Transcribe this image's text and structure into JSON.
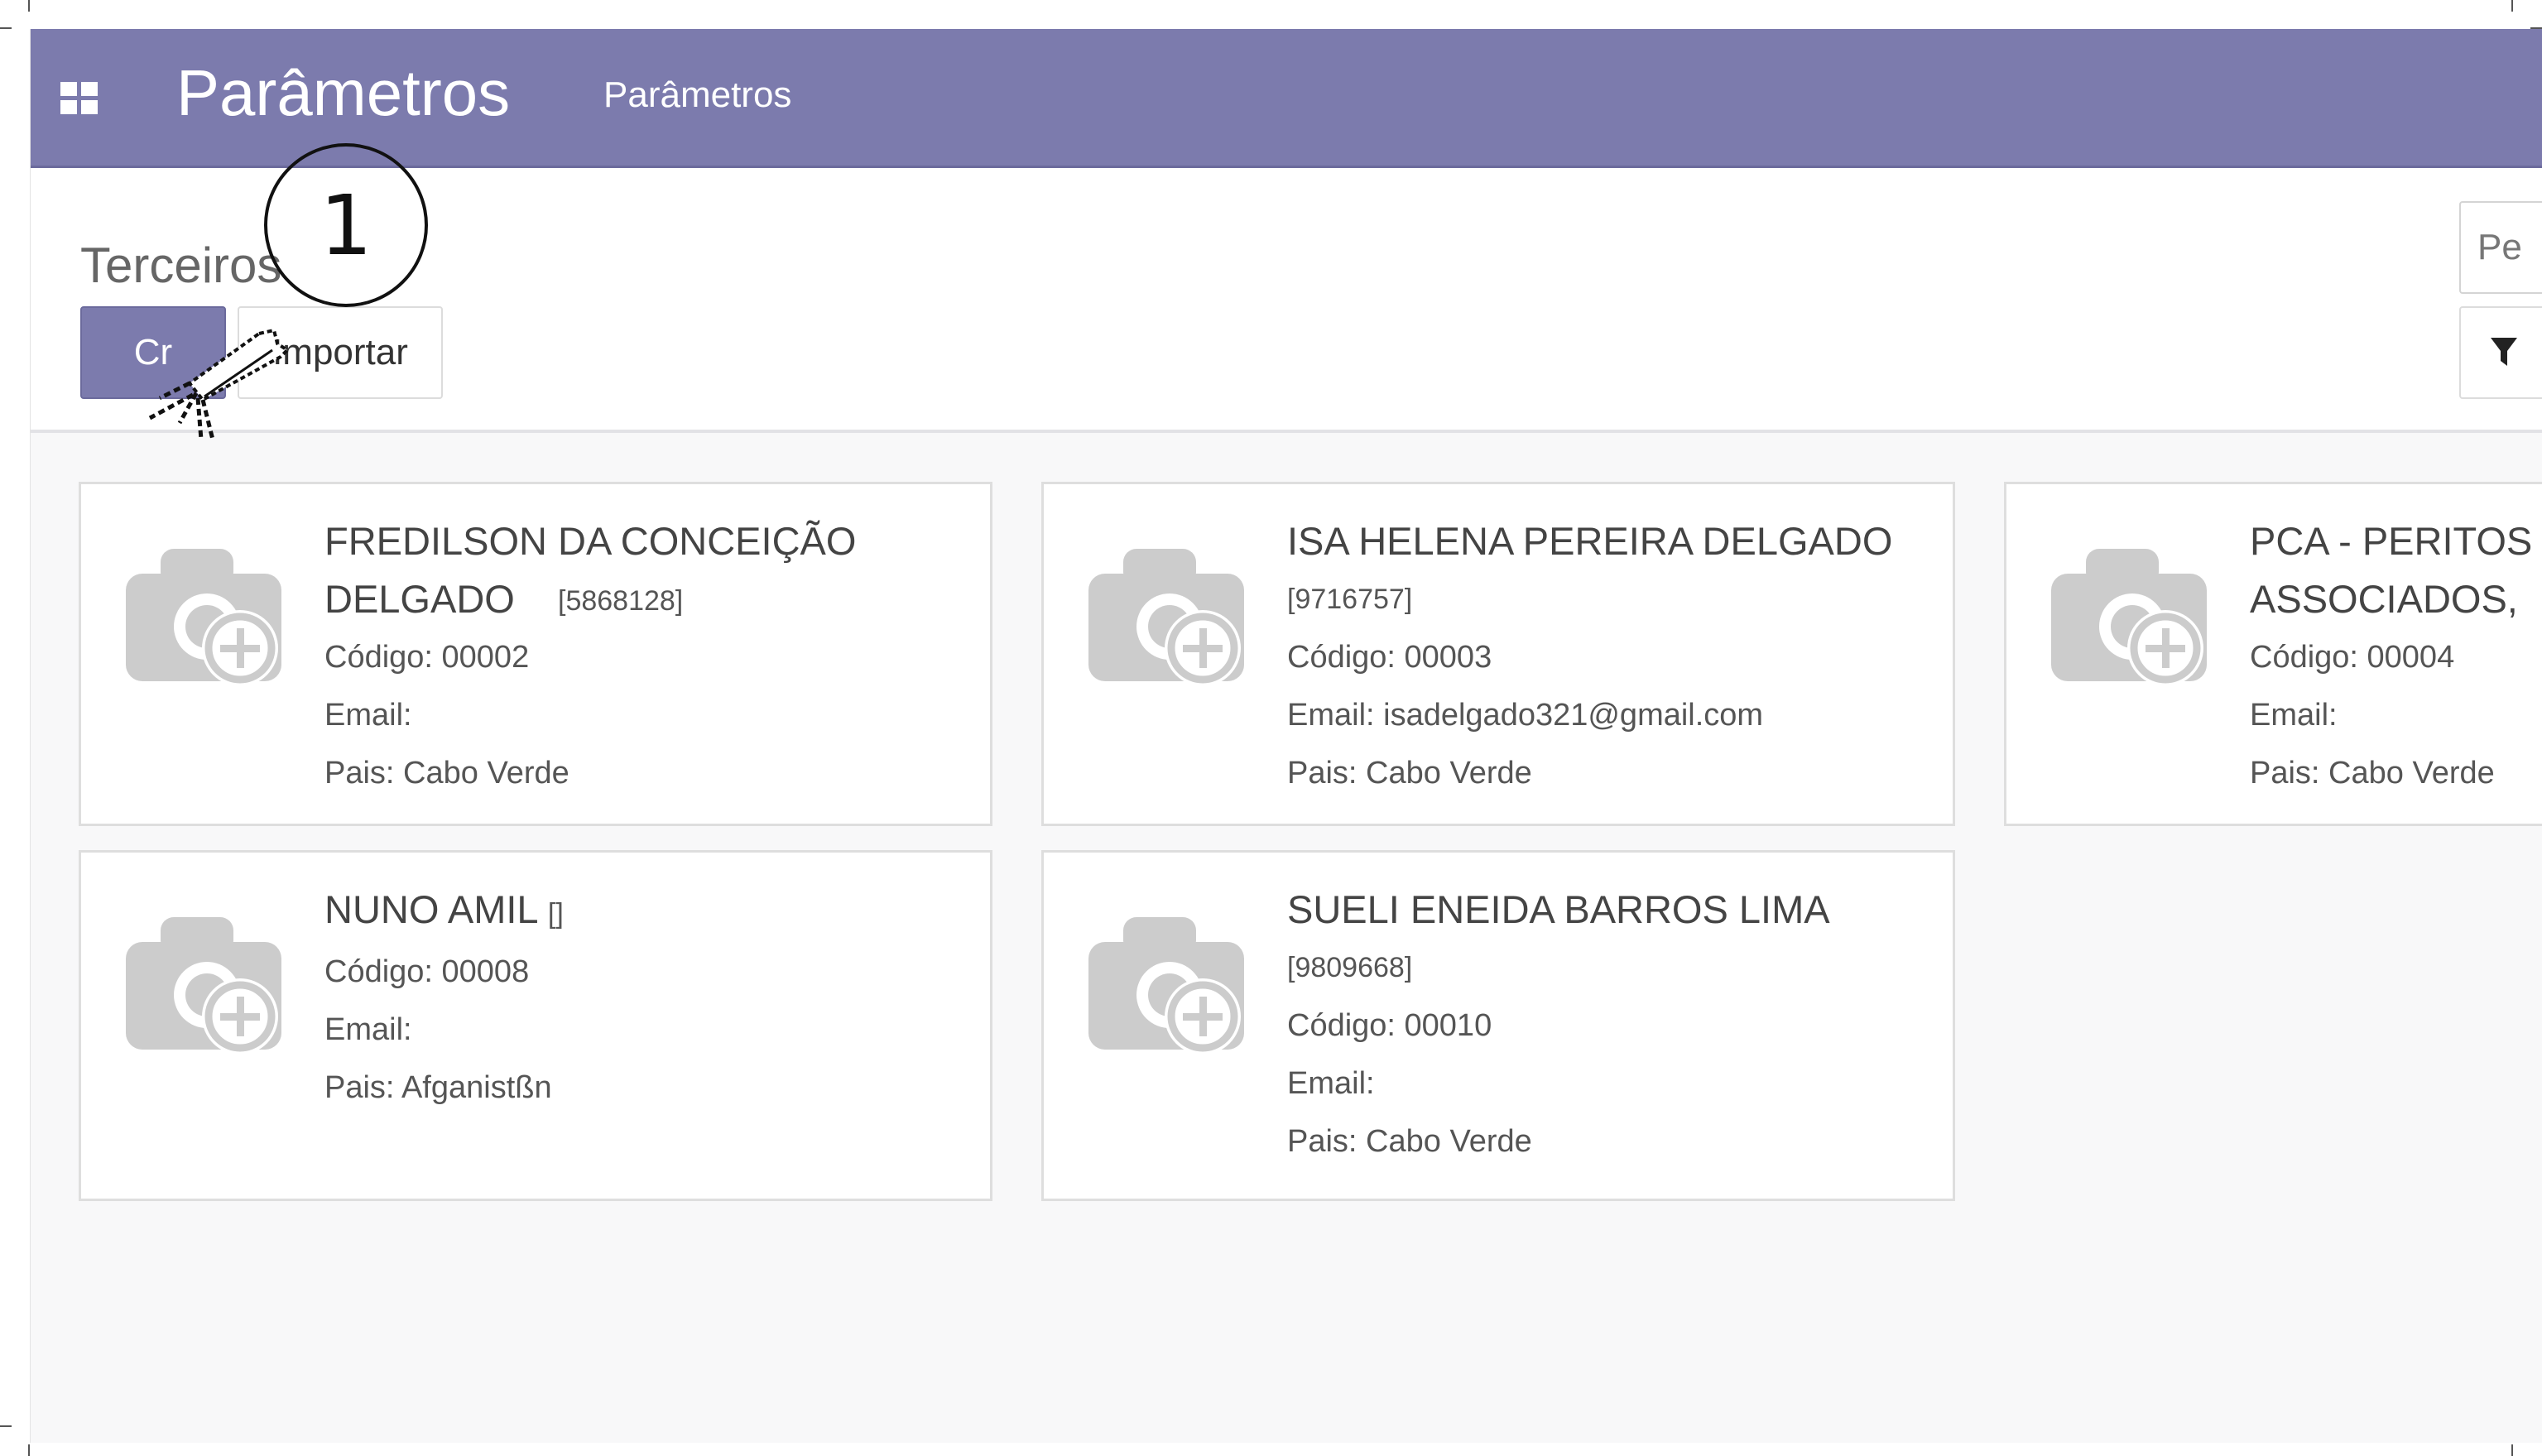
{
  "navbar": {
    "app_title": "Parâmetros",
    "menu_item": "Parâmetros"
  },
  "control_panel": {
    "breadcrumb": "Terceiros",
    "create_label": "Cr",
    "import_label": "Importar",
    "search_placeholder": "Pe"
  },
  "annotation": {
    "step_number": "1"
  },
  "cards": [
    {
      "name": "FREDILSON DA CONCEIÇÃO DELGADO",
      "ref": "[5868128]",
      "codigo": "Código: 00002",
      "email": "Email:",
      "pais": "Pais: Cabo Verde"
    },
    {
      "name": "ISA HELENA PEREIRA DELGADO",
      "ref": "[9716757]",
      "codigo": "Código: 00003",
      "email": "Email: isadelgado321@gmail.com",
      "pais": "Pais: Cabo Verde"
    },
    {
      "name": "PCA - PERITOS ASSOCIADOS,",
      "ref": "",
      "codigo": "Código: 00004",
      "email": "Email:",
      "pais": "Pais: Cabo Verde"
    },
    {
      "name": "NUNO AMIL",
      "ref": "[]",
      "codigo": "Código: 00008",
      "email": "Email:",
      "pais": "Pais: Afganistßn"
    },
    {
      "name": "SUELI ENEIDA BARROS LIMA",
      "ref": "[9809668]",
      "codigo": "Código: 00010",
      "email": "Email:",
      "pais": "Pais: Cabo Verde"
    }
  ],
  "icons": {
    "apps": "apps-grid-icon",
    "filter": "filter-icon",
    "placeholder_photo": "camera-add-icon",
    "cursor": "mouse-pointer-icon"
  },
  "colors": {
    "navbar": "#7c7bad",
    "create_button": "#7c7bad",
    "background": "#f8f8f9",
    "card_border": "#dedede",
    "placeholder_icon": "#cccccc"
  }
}
